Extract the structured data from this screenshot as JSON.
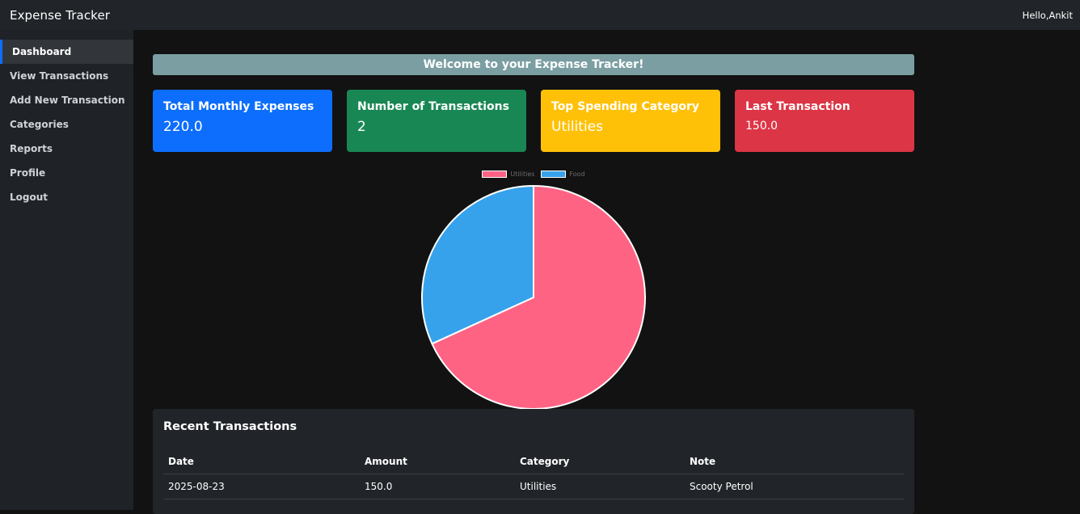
{
  "navbar": {
    "brand": "Expense Tracker",
    "greeting": "Hello,Ankit"
  },
  "sidebar": {
    "items": [
      {
        "label": "Dashboard",
        "active": true
      },
      {
        "label": "View Transactions"
      },
      {
        "label": "Add New Transaction"
      },
      {
        "label": "Categories"
      },
      {
        "label": "Reports"
      },
      {
        "label": "Profile"
      },
      {
        "label": "Logout"
      }
    ]
  },
  "main": {
    "welcome": "Welcome to your Expense Tracker!",
    "cards": [
      {
        "title": "Total Monthly Expenses",
        "value": "220.0",
        "color": "#0d6efd"
      },
      {
        "title": "Number of Transactions",
        "value": "2",
        "color": "#198754"
      },
      {
        "title": "Top Spending Category",
        "value": "Utilities",
        "color": "#ffc107"
      },
      {
        "title": "Last Transaction",
        "value": "150.0",
        "color": "#dc3545"
      }
    ],
    "recent": {
      "title": "Recent Transactions",
      "columns": [
        "Date",
        "Amount",
        "Category",
        "Note"
      ],
      "rows": [
        [
          "2025-08-23",
          "150.0",
          "Utilities",
          "Scooty Petrol"
        ]
      ]
    }
  },
  "chart_data": {
    "type": "pie",
    "categories": [
      "Utilities",
      "Food"
    ],
    "values": [
      150,
      70
    ],
    "colors": [
      "#ff6384",
      "#36a2eb"
    ],
    "legend": "top"
  }
}
